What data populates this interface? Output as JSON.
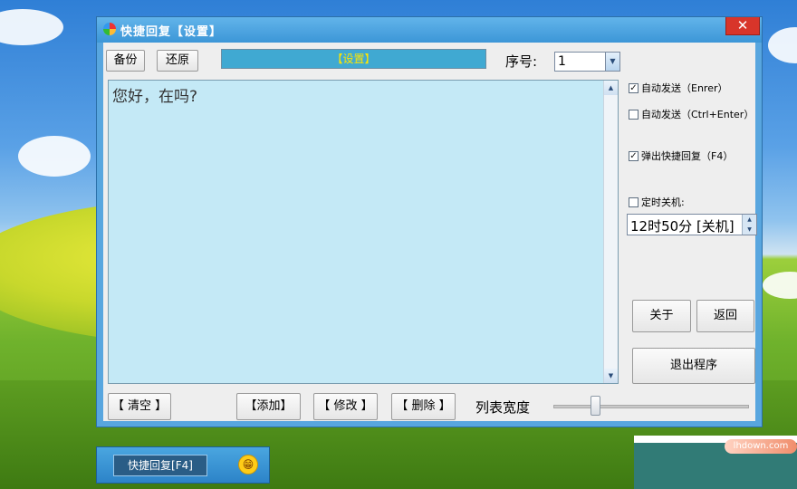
{
  "window": {
    "title": "快捷回复【设置】",
    "close_label": "✕"
  },
  "toolbar": {
    "backup_label": "备份",
    "restore_label": "还原",
    "banner_text": "【设置】",
    "seq_label": "序号:",
    "seq_value": "1"
  },
  "editor": {
    "text": "您好，在吗?"
  },
  "options": {
    "auto_send_enter": {
      "label": "自动发送（Enrer）",
      "checked": true
    },
    "auto_send_ctrl_enter": {
      "label": "自动发送（Ctrl+Enter）",
      "checked": false
    },
    "popup_quick_reply": {
      "label": "弹出快捷回复（F4）",
      "checked": true
    },
    "timed_shutdown": {
      "label": "定时关机:",
      "checked": false,
      "value": "12时50分 [关机]"
    }
  },
  "side_buttons": {
    "about_label": "关于",
    "back_label": "返回",
    "exit_label": "退出程序"
  },
  "bottom_buttons": {
    "clear_label": "【 清空 】",
    "add_label": "【添加】",
    "edit_label": "【 修改 】",
    "delete_label": "【 删除 】"
  },
  "list_width": {
    "label": "列表宽度",
    "level_fraction": 0.21
  },
  "taskbar": {
    "button_label": "快捷回复[F4]",
    "emoji": "😁"
  },
  "watermark": {
    "text": "lhdown.com"
  },
  "colors": {
    "window_blue": "#58a6df",
    "editor_bg": "#c4e9f6",
    "banner_bg": "#40a9d2",
    "banner_text": "#ffe600",
    "close_red": "#d8352a"
  }
}
